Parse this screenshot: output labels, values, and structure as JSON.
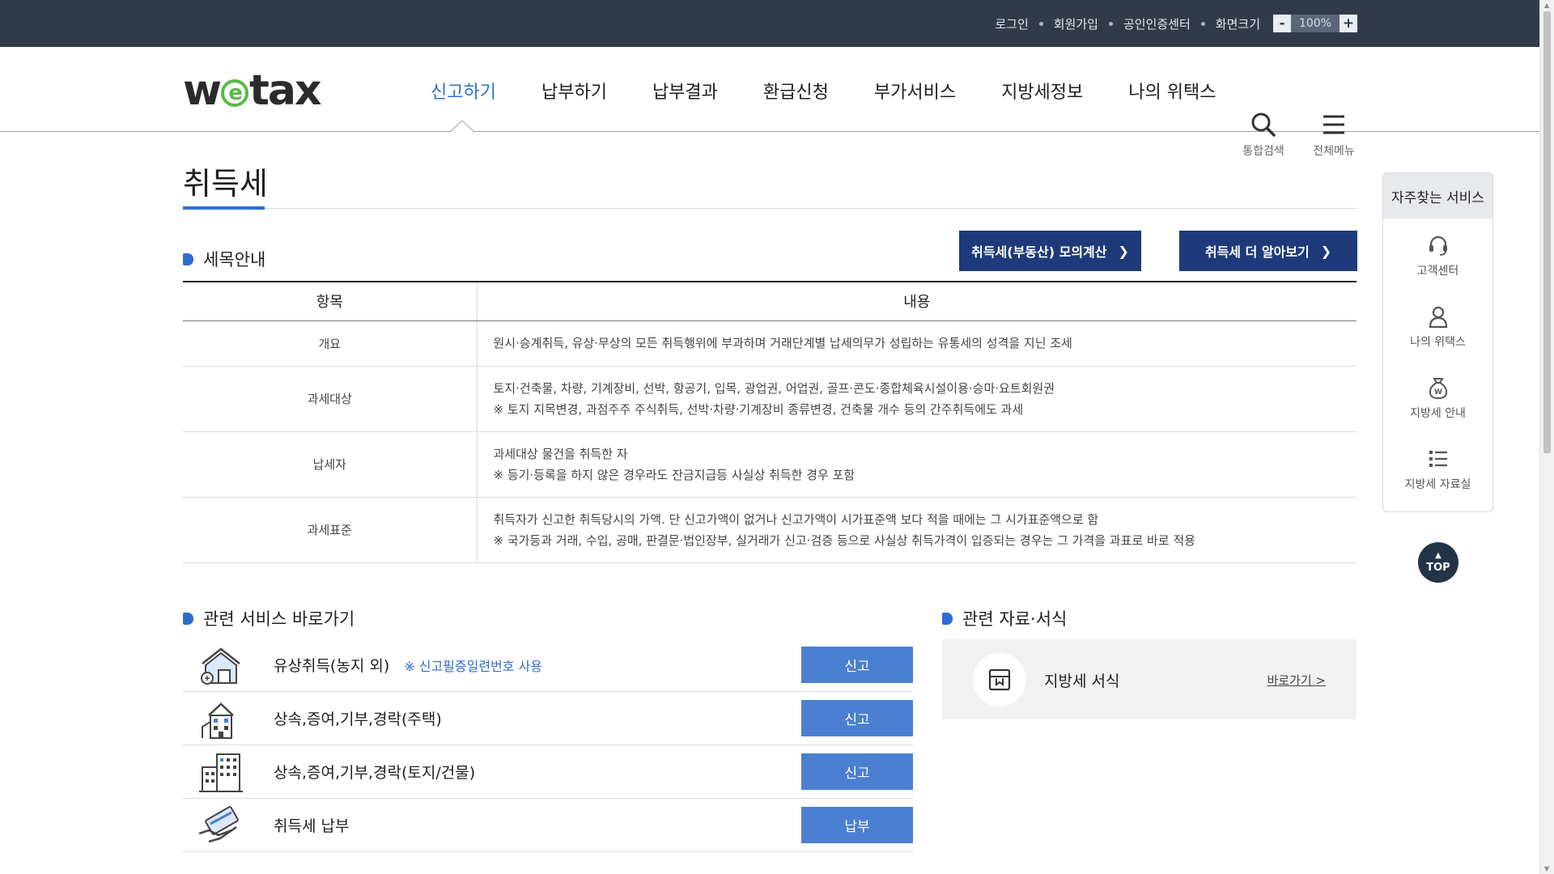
{
  "util": {
    "login": "로그인",
    "join": "회원가입",
    "cert": "공인인증센터",
    "screen_size": "화면크기",
    "zoom_minus": "-",
    "zoom_value": "100%",
    "zoom_plus": "+"
  },
  "header": {
    "logo_w": "w",
    "logo_e": "e",
    "logo_tax": "tax",
    "nav": [
      "신고하기",
      "납부하기",
      "납부결과",
      "환급신청",
      "부가서비스",
      "지방세정보",
      "나의 위택스"
    ],
    "active_nav": "신고하기",
    "search_label": "통합검색",
    "menu_label": "전체메뉴"
  },
  "page": {
    "title": "취득세"
  },
  "guide": {
    "heading": "세목안내",
    "btn_simulate": "취득세(부동산) 모의계산",
    "btn_more": "취득세 더 알아보기",
    "col_item": "항목",
    "col_content": "내용",
    "rows": [
      {
        "item": "개요",
        "line1": "원시·승계취득, 유상·무상의 모든 취득행위에 부과하며 거래단계별 납세의무가 성립하는 유통세의 성격을 지닌 조세",
        "line2": ""
      },
      {
        "item": "과세대상",
        "line1": "토지·건축물, 차량, 기계장비, 선박, 항공기, 입목, 광업권, 어업권, 골프·콘도·종합체육시설이용·승마·요트회원권",
        "line2": "※ 토지 지목변경, 과점주주 주식취득, 선박·차량·기계장비 종류변경, 건축물 개수 등의 간주취득에도 과세"
      },
      {
        "item": "납세자",
        "line1": "과세대상 물건을 취득한 자",
        "line2": "※ 등기·등록을 하지 않은 경우라도 잔금지급등 사실상 취득한 경우 포함"
      },
      {
        "item": "과세표준",
        "line1": "취득자가 신고한 취득당시의 가액. 단 신고가액이 없거나 신고가액이 시가표준액 보다 적을 때에는 그 시가표준액으로 함",
        "line2": "※ 국가등과 거래, 수입, 공매, 판결문·법인장부, 실거래가 신고·검증 등으로 사실상 취득가격이 입증되는 경우는 그 가격을 과표로 바로 적용"
      }
    ]
  },
  "services": {
    "heading": "관련 서비스 바로가기",
    "items": [
      {
        "label": "유상취득(농지 외)",
        "note": "※ 신고필증일련번호 사용",
        "button": "신고",
        "icon": "house-icon"
      },
      {
        "label": "상속,증여,기부,경락(주택)",
        "note": "",
        "button": "신고",
        "icon": "home-building-icon"
      },
      {
        "label": "상속,증여,기부,경락(토지/건물)",
        "note": "",
        "button": "신고",
        "icon": "office-building-icon"
      },
      {
        "label": "취득세 납부",
        "note": "",
        "button": "납부",
        "icon": "card-payment-icon"
      }
    ]
  },
  "forms": {
    "heading": "관련 자료·서식",
    "title": "지방세 서식",
    "link": "바로가기 >"
  },
  "quick": {
    "title": "자주찾는 서비스",
    "items": [
      "고객센터",
      "나의 위택스",
      "지방세 안내",
      "지방세 자료실"
    ],
    "top": "TOP"
  },
  "colors": {
    "topbar": "#323a4a",
    "accent": "#2e6fd0",
    "dark_button": "#1e3a7a",
    "service_button": "#4a7fd1",
    "logo_green": "#58b947"
  }
}
